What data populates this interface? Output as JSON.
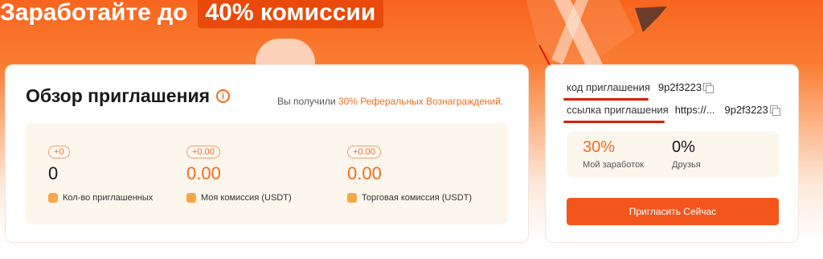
{
  "banner": {
    "title_prefix": "Заработайте до",
    "title_highlight": "40% комиссии"
  },
  "overview": {
    "title": "Обзор приглашения",
    "ref_note_prefix": "Вы получили",
    "ref_note_accent": "30% Реферальных Вознаграждений.",
    "stats": [
      {
        "delta": "+0",
        "value": "0",
        "label": "Кол-во приглашенных",
        "value_color": "dark"
      },
      {
        "delta": "+0.00",
        "value": "0.00",
        "label": "Моя комиссия (USDT)",
        "value_color": "orange"
      },
      {
        "delta": "+0.00",
        "value": "0.00",
        "label": "Торговая комиссия (USDT)",
        "value_color": "orange"
      }
    ]
  },
  "invite_panel": {
    "code_label": "код приглашения",
    "code_value": "9p2f3223",
    "link_label": "ссылка приглашения",
    "link_value_prefix": "https://...",
    "link_value_suffix": "9p2f3223",
    "earn_rate": "30%",
    "earn_rate_label": "Мой заработок",
    "friends_rate": "0%",
    "friends_rate_label": "Друзья",
    "invite_button": "Пригласить Сейчас"
  },
  "colors": {
    "accent": "#f26b21",
    "button": "#f2561d",
    "annotation_red": "#d81e06"
  }
}
